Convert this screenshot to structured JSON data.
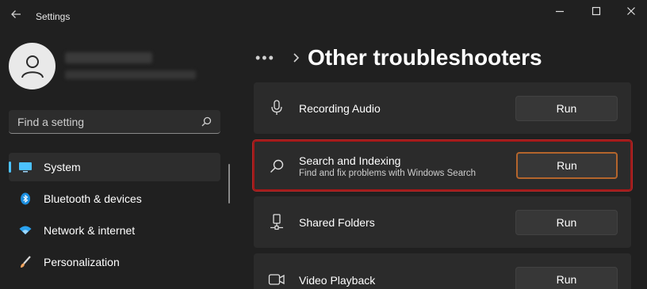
{
  "window": {
    "app_title": "Settings",
    "accent_color": "#4cc2ff",
    "highlight_color": "#a01818"
  },
  "sidebar": {
    "search": {
      "placeholder": "Find a setting"
    },
    "items": [
      {
        "label": "System",
        "icon": "monitor-icon",
        "selected": true
      },
      {
        "label": "Bluetooth & devices",
        "icon": "bluetooth-icon",
        "selected": false
      },
      {
        "label": "Network & internet",
        "icon": "wifi-icon",
        "selected": false
      },
      {
        "label": "Personalization",
        "icon": "brush-icon",
        "selected": false
      }
    ]
  },
  "main": {
    "breadcrumb_more": "•••",
    "page_title": "Other troubleshooters",
    "items": [
      {
        "title": "Recording Audio",
        "subtitle": "",
        "icon": "microphone-icon",
        "button": "Run"
      },
      {
        "title": "Search and Indexing",
        "subtitle": "Find and fix problems with Windows Search",
        "icon": "search-icon",
        "button": "Run",
        "highlighted": true
      },
      {
        "title": "Shared Folders",
        "subtitle": "",
        "icon": "network-drive-icon",
        "button": "Run"
      },
      {
        "title": "Video Playback",
        "subtitle": "",
        "icon": "video-camera-icon",
        "button": "Run"
      }
    ]
  }
}
